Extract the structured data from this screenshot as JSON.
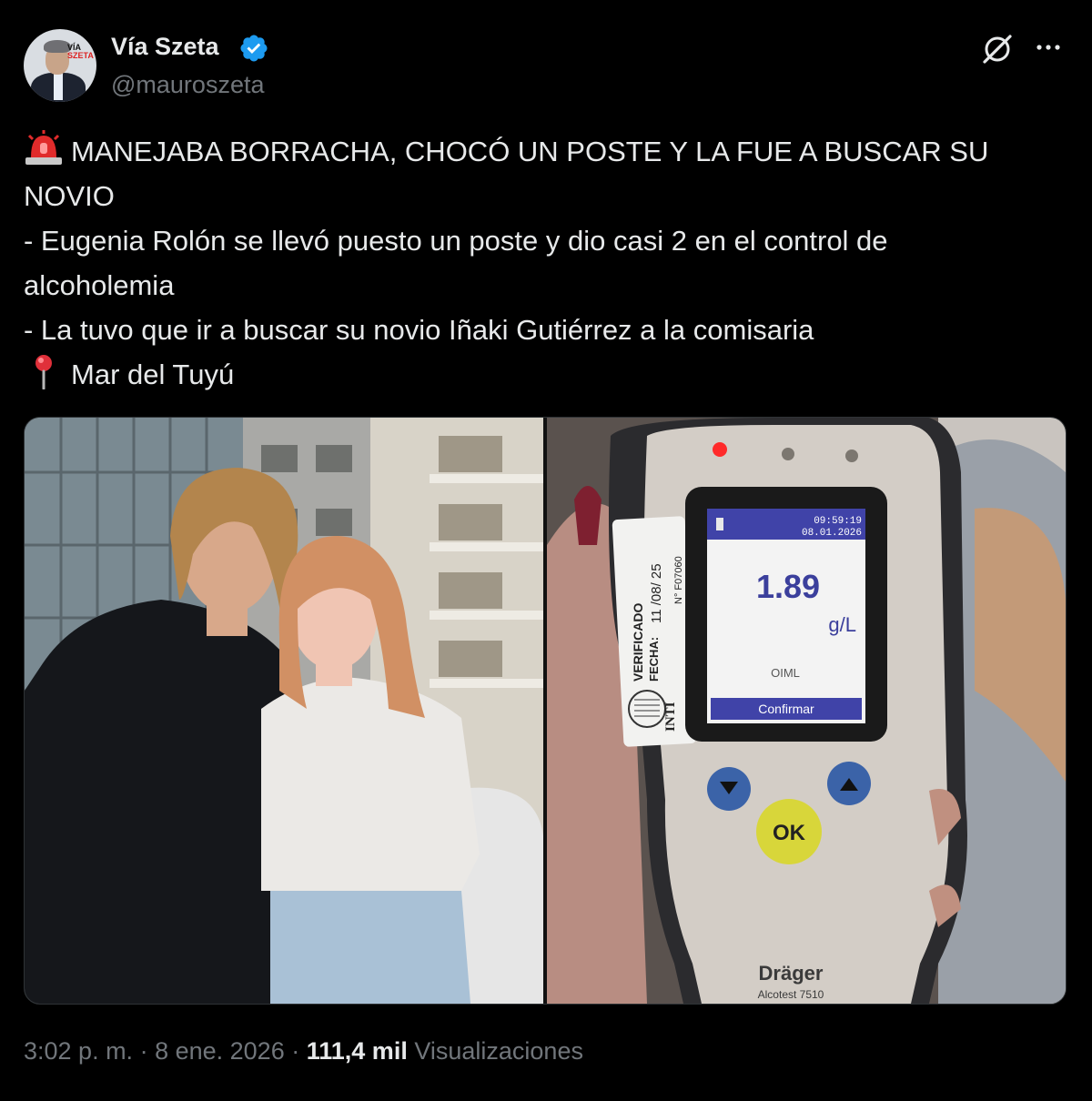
{
  "author": {
    "name": "Vía Szeta",
    "handle": "@mauroszeta",
    "avatar_logo_top": "VÍA",
    "avatar_logo_bottom": "SZETA",
    "verified": true
  },
  "header_icons": [
    "grok-icon",
    "more-options-icon"
  ],
  "tweet": {
    "lines": [
      {
        "emoji": "police-light-icon",
        "text": "MANEJABA BORRACHA, CHOCÓ UN POSTE Y LA FUE A BUSCAR SU"
      },
      {
        "emoji": "",
        "text": "NOVIO"
      },
      {
        "emoji": "",
        "text": "- Eugenia Rolón se llevó puesto un poste y dio casi 2 en el control de"
      },
      {
        "emoji": "",
        "text": "alcoholemia"
      },
      {
        "emoji": "",
        "text": "- La tuvo que ir a buscar su novio Iñaki Gutiérrez a la comisaria"
      },
      {
        "emoji": "round-pushpin-icon",
        "text": "Mar del Tuyú"
      }
    ]
  },
  "media": {
    "breathalyzer": {
      "time": "09:59:19",
      "date": "08.01.2026",
      "reading": "1.89",
      "unit": "g/L",
      "standard": "OIML",
      "confirm_label": "Confirmar",
      "ok_label": "OK",
      "brand": "Dräger",
      "model": "Alcotest 7510",
      "sticker_verified": "VERIFICADO",
      "sticker_fecha": "FECHA:",
      "sticker_date": "11 /08/ 25",
      "sticker_number": "N° F07060",
      "sticker_inti": "INTI"
    }
  },
  "footer": {
    "time": "3:02 p. m.",
    "separator": " · ",
    "date": "8 ene. 2026",
    "views_count": "111,4 mil",
    "views_label": "Visualizaciones"
  },
  "colors": {
    "background": "#000000",
    "text": "#e7e9ea",
    "secondary": "#71767b",
    "verified": "#1d9bf0",
    "border": "#2f3336"
  }
}
